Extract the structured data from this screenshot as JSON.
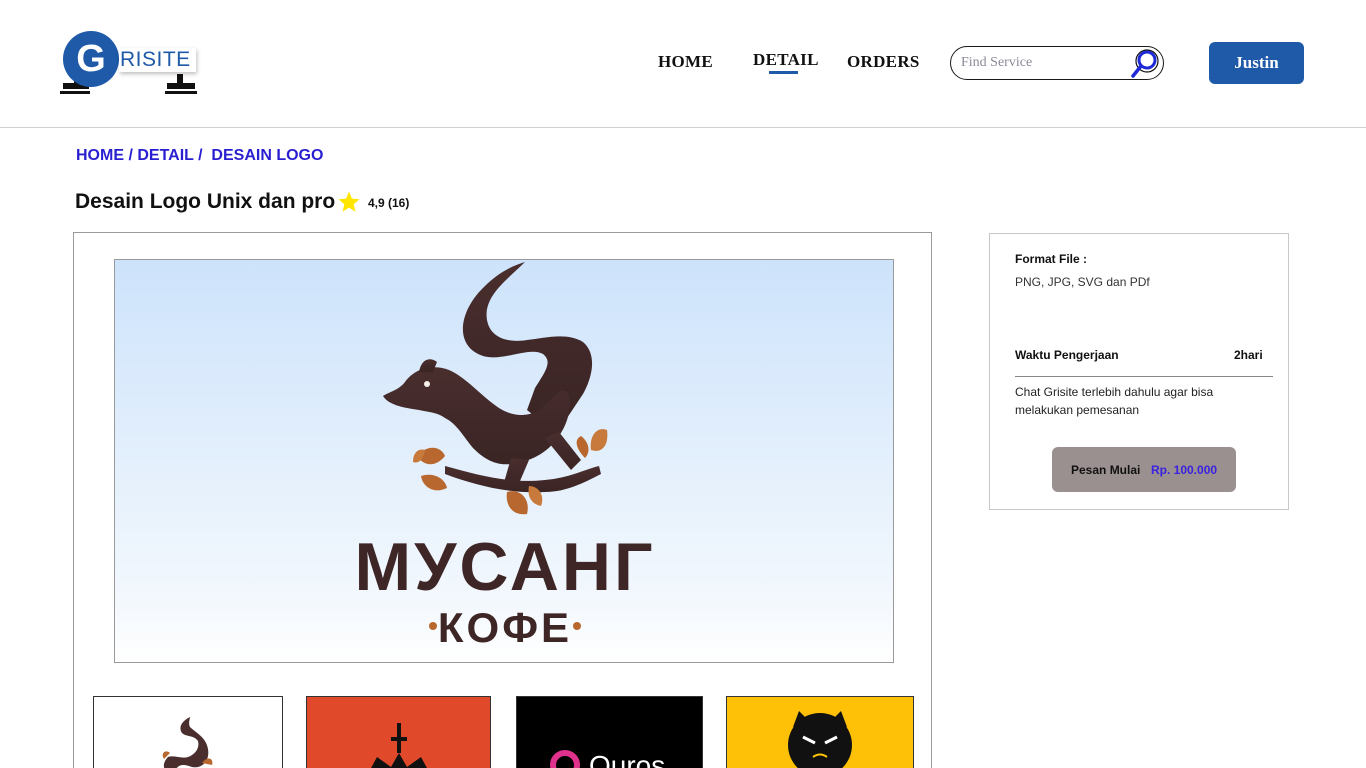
{
  "brand": {
    "logo_letter": "G",
    "logo_text": "RISITE"
  },
  "nav": [
    {
      "label": "HOME"
    },
    {
      "label": "DETAIL"
    },
    {
      "label": "ORDERS"
    }
  ],
  "search": {
    "placeholder": "Find Service",
    "value": ""
  },
  "user": {
    "name": "Justin"
  },
  "breadcrumb": {
    "home": "HOME",
    "sep1": " / ",
    "detail": "DETAIL",
    "sep2": " /  ",
    "current": "DESAIN LOGO"
  },
  "product": {
    "title": "Desain Logo Unix dan pro",
    "rating": "4,9 (16)"
  },
  "gallery": {
    "main_logo_line1": "МУСАНГ",
    "main_logo_line2": "КОФЕ",
    "thumbnails": [
      {
        "background": "#ffffff"
      },
      {
        "background": "#e04a2a"
      },
      {
        "background": "#000000",
        "text": "Quros"
      },
      {
        "background": "#ffc107"
      }
    ]
  },
  "panel": {
    "format_label": "Format File :",
    "format_value": "PNG, JPG, SVG dan PDf",
    "time_label": "Waktu Pengerjaan",
    "time_value": "2hari",
    "note_line1": "Chat Grisite terlebih dahulu agar bisa",
    "note_line2": "melakukan pemesanan",
    "order_label": "Pesan Mulai",
    "order_price": "Rp. 100.000"
  },
  "colors": {
    "brand": "#1e5aa8",
    "breadcrumb": "#2a1fd0",
    "price": "#3b22e0",
    "star": "#ffe600"
  }
}
